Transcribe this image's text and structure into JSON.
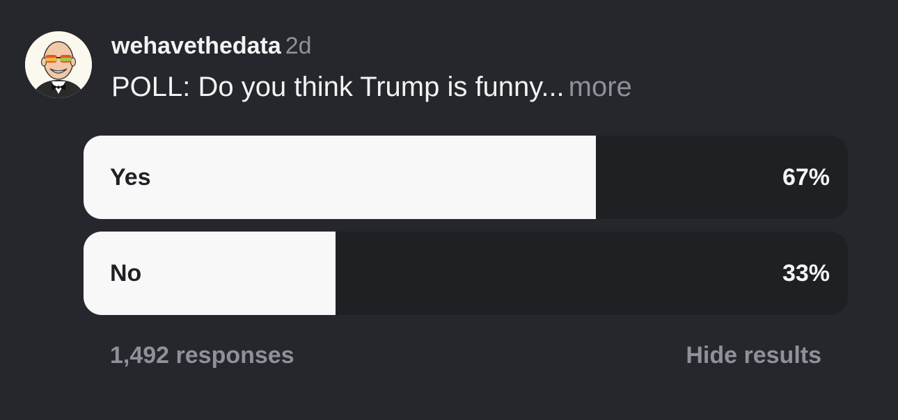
{
  "post": {
    "username": "wehavethedata",
    "time": "2d",
    "text": "POLL: Do you think Trump is funny...",
    "more_label": "more",
    "avatar_icon": "cartoon-avatar-sunglasses-bowtie"
  },
  "poll": {
    "options": [
      {
        "label": "Yes",
        "percent_label": "67%",
        "percent": 67
      },
      {
        "label": "No",
        "percent_label": "33%",
        "percent": 33
      }
    ],
    "responses": "1,492 responses",
    "hide_results_label": "Hide results"
  },
  "colors": {
    "background": "#25272c",
    "bar_fill": "#f8f8f8",
    "bar_track": "#1e2024",
    "muted_text": "#8e9199"
  }
}
